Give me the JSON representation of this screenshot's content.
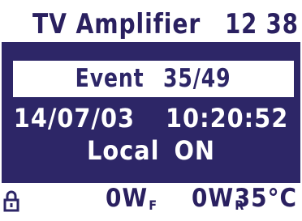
{
  "header": {
    "title": "TV Amplifier",
    "clock": "12 38"
  },
  "event": {
    "label": "Event",
    "counter": "35/49",
    "date": "14/07/03",
    "time": "10:20:52",
    "mode_label": "Local",
    "mode_state": "ON"
  },
  "status": {
    "lock_icon": "padlock-icon",
    "forward_power": "0W",
    "forward_sub": "F",
    "reflected_power": "0W",
    "reflected_sub": "R",
    "temperature": "35°C"
  },
  "colors": {
    "foreground": "#2d2667",
    "background": "#ffffff"
  }
}
